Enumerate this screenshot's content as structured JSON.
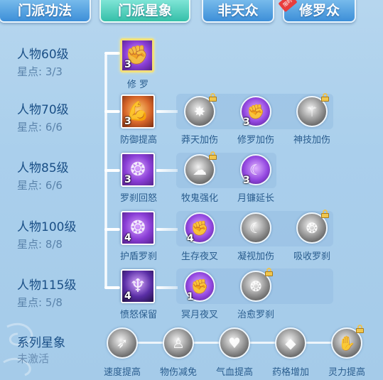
{
  "tabs": [
    {
      "label": "门派功法"
    },
    {
      "label": "门派星象"
    },
    {
      "label": "非天众"
    },
    {
      "label": "修罗众",
      "badge": "限时"
    }
  ],
  "levels": [
    {
      "title": "人物60级",
      "stars": "星点: 3/3"
    },
    {
      "title": "人物70级",
      "stars": "星点: 6/6"
    },
    {
      "title": "人物85级",
      "stars": "星点: 6/6"
    },
    {
      "title": "人物100级",
      "stars": "星点: 8/8"
    },
    {
      "title": "人物115级",
      "stars": "星点: 5/8"
    }
  ],
  "rows": [
    {
      "main": {
        "label": "修 罗",
        "num": "3",
        "icon": "shura-fist-icon"
      },
      "subs": []
    },
    {
      "main": {
        "label": "防御提高",
        "num": "3",
        "icon": "strong-arm-icon"
      },
      "subs": [
        {
          "label": "莽天加伤",
          "num": "",
          "locked": true,
          "icon": "burst-icon"
        },
        {
          "label": "修罗加伤",
          "num": "3",
          "locked": false,
          "icon": "shura-fist-icon"
        },
        {
          "label": "神技加伤",
          "num": "",
          "locked": true,
          "icon": "claw-icon"
        }
      ]
    },
    {
      "main": {
        "label": "罗刹回怒",
        "num": "3",
        "icon": "rage-orb-icon"
      },
      "subs": [
        {
          "label": "牧鬼强化",
          "num": "",
          "locked": true,
          "icon": "ghost-icon"
        },
        {
          "label": "月镰延长",
          "num": "3",
          "locked": false,
          "icon": "moon-scythe-icon"
        }
      ]
    },
    {
      "main": {
        "label": "护盾罗刹",
        "num": "4",
        "icon": "shield-beast-icon"
      },
      "subs": [
        {
          "label": "生存夜叉",
          "num": "4",
          "locked": false,
          "icon": "yaksha-icon"
        },
        {
          "label": "凝视加伤",
          "num": "",
          "locked": false,
          "icon": "gaze-icon"
        },
        {
          "label": "吸收罗刹",
          "num": "",
          "locked": true,
          "icon": "absorb-icon"
        }
      ]
    },
    {
      "main": {
        "label": "愤怒保留",
        "num": "4",
        "icon": "demon-figure-icon"
      },
      "subs": [
        {
          "label": "冥月夜叉",
          "num": "1",
          "locked": false,
          "icon": "yaksha-icon"
        },
        {
          "label": "治愈罗刹",
          "num": "",
          "locked": true,
          "icon": "heal-beast-icon"
        }
      ]
    }
  ],
  "series": {
    "title": "系列星象",
    "status": "未激活",
    "items": [
      {
        "label": "速度提高",
        "locked": false,
        "icon": "speed-icon"
      },
      {
        "label": "物伤减免",
        "locked": false,
        "icon": "figure-icon"
      },
      {
        "label": "气血提高",
        "locked": false,
        "icon": "heart-icon"
      },
      {
        "label": "药格增加",
        "locked": false,
        "icon": "crystal-icon"
      },
      {
        "label": "灵力提高",
        "locked": true,
        "icon": "spirit-hand-icon"
      }
    ]
  }
}
